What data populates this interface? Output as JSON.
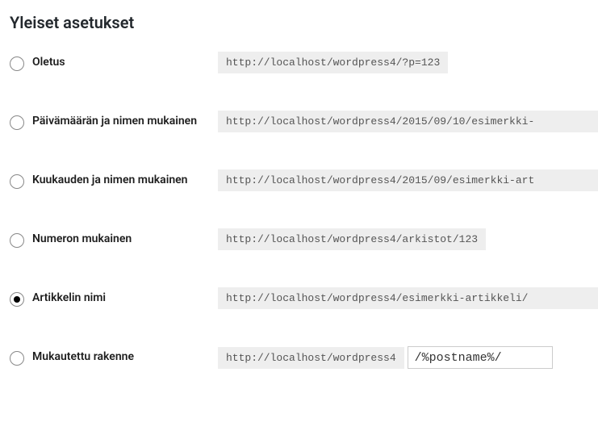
{
  "title": "Yleiset asetukset",
  "options": [
    {
      "label": "Oletus",
      "url": "http://localhost/wordpress4/?p=123",
      "selected": false
    },
    {
      "label": "Päivämäärän ja nimen mukainen",
      "url": "http://localhost/wordpress4/2015/09/10/esimerkki-",
      "selected": false
    },
    {
      "label": "Kuukauden ja nimen mukainen",
      "url": "http://localhost/wordpress4/2015/09/esimerkki-art",
      "selected": false
    },
    {
      "label": "Numeron mukainen",
      "url": "http://localhost/wordpress4/arkistot/123",
      "selected": false
    },
    {
      "label": "Artikkelin nimi",
      "url": "http://localhost/wordpress4/esimerkki-artikkeli/",
      "selected": true
    },
    {
      "label": "Mukautettu rakenne",
      "url": "http://localhost/wordpress4",
      "selected": false
    }
  ],
  "custom_input_value": "/%postname%/"
}
